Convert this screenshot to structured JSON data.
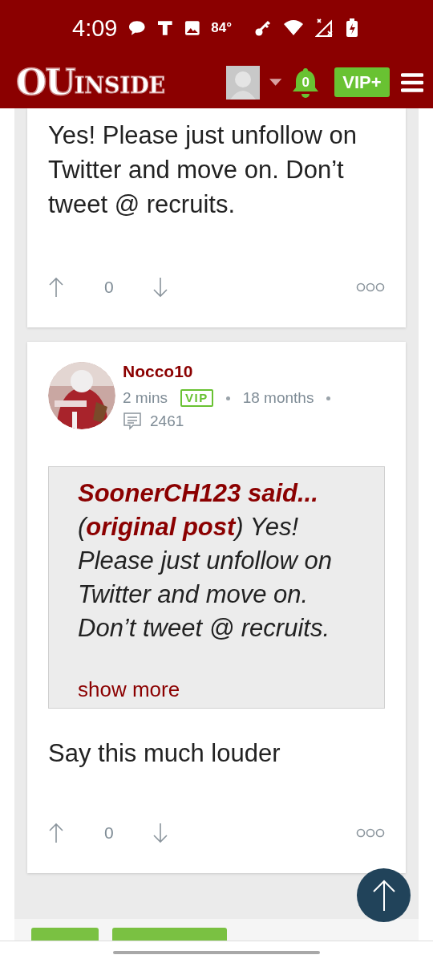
{
  "status_bar": {
    "time": "4:09",
    "temperature": "84°"
  },
  "header": {
    "logo_main": "OU",
    "logo_rest": "INSIDE",
    "notifications": "0",
    "vip_button": "VIP+"
  },
  "posts": [
    {
      "kind": "cut",
      "body": "Yes! Please just unfollow on Twitter and move on. Don’t tweet @ recruits.",
      "votes": "0"
    },
    {
      "kind": "full",
      "author": "Nocco10",
      "time": "2 mins",
      "badge": "VIP",
      "tenure": "18 months",
      "post_count": "2461",
      "quote": {
        "author": "SoonerCH123 said...",
        "text": "(**original post**) Yes! Please just unfollow on Twitter and move on. Don’t tweet @ recruits.",
        "more": "show more"
      },
      "body": "Say this much louder",
      "votes": "0"
    }
  ]
}
